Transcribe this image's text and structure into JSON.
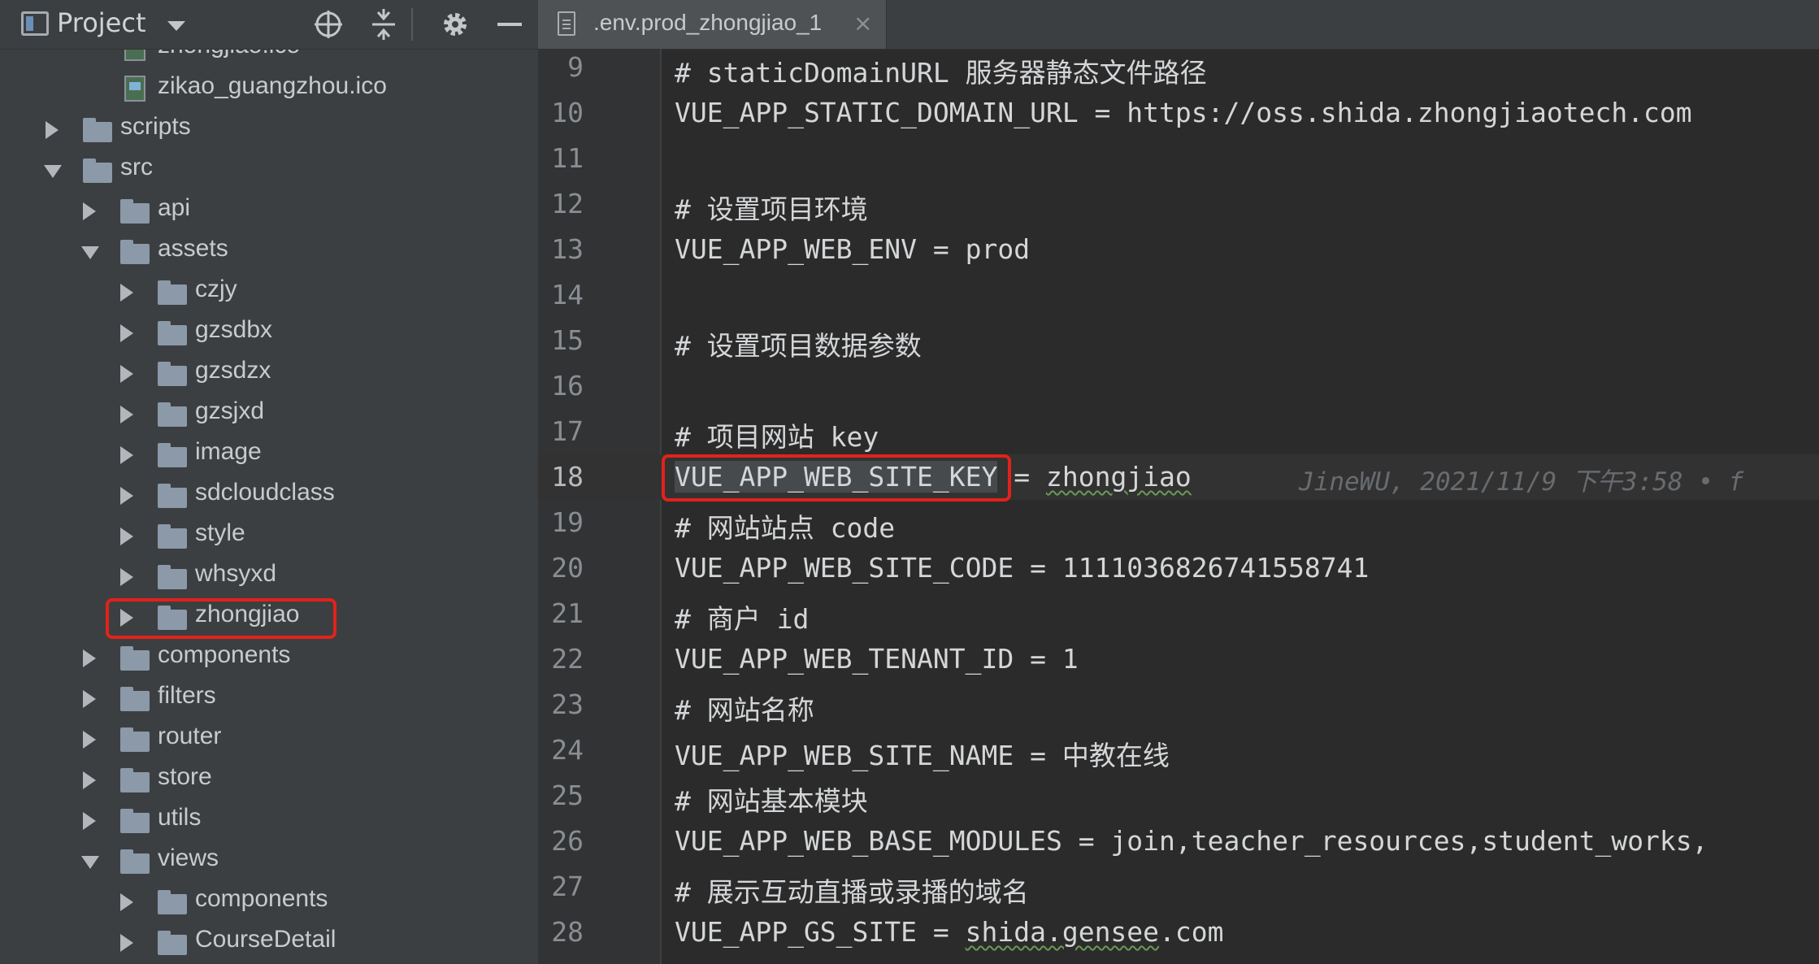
{
  "project_panel": {
    "title": "Project",
    "tree": [
      {
        "label": "zhongjiao.ico",
        "type": "file",
        "depth": 3
      },
      {
        "label": "zikao_guangzhou.ico",
        "type": "file",
        "depth": 3
      },
      {
        "label": "scripts",
        "type": "folder",
        "depth": 1,
        "expanded": false
      },
      {
        "label": "src",
        "type": "folder",
        "depth": 1,
        "expanded": true
      },
      {
        "label": "api",
        "type": "folder",
        "depth": 2,
        "expanded": false
      },
      {
        "label": "assets",
        "type": "folder",
        "depth": 2,
        "expanded": true
      },
      {
        "label": "czjy",
        "type": "folder",
        "depth": 3,
        "expanded": false
      },
      {
        "label": "gzsdbx",
        "type": "folder",
        "depth": 3,
        "expanded": false
      },
      {
        "label": "gzsdzx",
        "type": "folder",
        "depth": 3,
        "expanded": false
      },
      {
        "label": "gzsjxd",
        "type": "folder",
        "depth": 3,
        "expanded": false
      },
      {
        "label": "image",
        "type": "folder",
        "depth": 3,
        "expanded": false
      },
      {
        "label": "sdcloudclass",
        "type": "folder",
        "depth": 3,
        "expanded": false
      },
      {
        "label": "style",
        "type": "folder",
        "depth": 3,
        "expanded": false
      },
      {
        "label": "whsyxd",
        "type": "folder",
        "depth": 3,
        "expanded": false
      },
      {
        "label": "zhongjiao",
        "type": "folder",
        "depth": 3,
        "expanded": false,
        "highlighted": true
      },
      {
        "label": "components",
        "type": "folder",
        "depth": 2,
        "expanded": false
      },
      {
        "label": "filters",
        "type": "folder",
        "depth": 2,
        "expanded": false
      },
      {
        "label": "router",
        "type": "folder",
        "depth": 2,
        "expanded": false
      },
      {
        "label": "store",
        "type": "folder",
        "depth": 2,
        "expanded": false
      },
      {
        "label": "utils",
        "type": "folder",
        "depth": 2,
        "expanded": false
      },
      {
        "label": "views",
        "type": "folder",
        "depth": 2,
        "expanded": true
      },
      {
        "label": "components",
        "type": "folder",
        "depth": 3,
        "expanded": false
      },
      {
        "label": "CourseDetail",
        "type": "folder",
        "depth": 3,
        "expanded": false
      }
    ]
  },
  "editor": {
    "tab_label": ".env.prod_zhongjiao_1",
    "tab_close": "×",
    "lines": [
      {
        "num": "9",
        "text": "# staticDomainURL 服务器静态文件路径"
      },
      {
        "num": "10",
        "text": "VUE_APP_STATIC_DOMAIN_URL = https://oss.shida.zhongjiaotech.com"
      },
      {
        "num": "11",
        "text": ""
      },
      {
        "num": "12",
        "text": "# 设置项目环境"
      },
      {
        "num": "13",
        "text": "VUE_APP_WEB_ENV = prod"
      },
      {
        "num": "14",
        "text": ""
      },
      {
        "num": "15",
        "text": "# 设置项目数据参数"
      },
      {
        "num": "16",
        "text": ""
      },
      {
        "num": "17",
        "text": "# 项目网站 key"
      },
      {
        "num": "18",
        "key": "VUE_APP_WEB_SITE_KEY",
        "rest": " = ",
        "value": "zhongjiao",
        "blame": "JineWU, 2021/11/9 下午3:58 • f",
        "current": true,
        "highlighted": true
      },
      {
        "num": "19",
        "text": "# 网站站点 code"
      },
      {
        "num": "20",
        "text": "VUE_APP_WEB_SITE_CODE = 1111036826741558741"
      },
      {
        "num": "21",
        "text": "# 商户 id"
      },
      {
        "num": "22",
        "text": "VUE_APP_WEB_TENANT_ID = 1"
      },
      {
        "num": "23",
        "text": "# 网站名称"
      },
      {
        "num": "24",
        "text": "VUE_APP_WEB_SITE_NAME = 中教在线"
      },
      {
        "num": "25",
        "text": "# 网站基本模块"
      },
      {
        "num": "26",
        "text": "VUE_APP_WEB_BASE_MODULES = join,teacher_resources,student_works,"
      },
      {
        "num": "27",
        "text": "# 展示互动直播或录播的域名"
      },
      {
        "num": "28",
        "prefix": "VUE_APP_GS_SITE = ",
        "wavy": "shida.gensee",
        "suffix": ".com"
      }
    ]
  },
  "colors": {
    "panel_bg": "#3c3f41",
    "editor_bg": "#2b2b2b",
    "highlight_box": "#e2221b"
  }
}
